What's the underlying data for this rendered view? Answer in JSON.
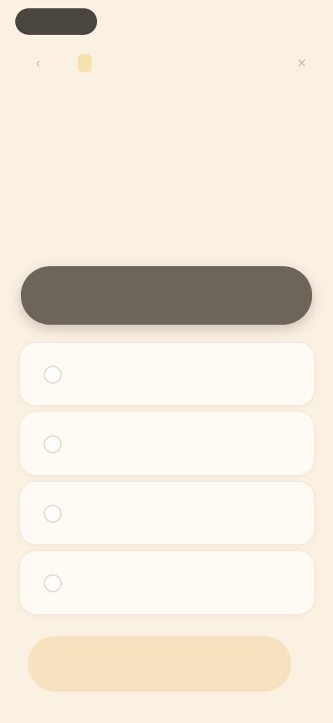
{
  "status_pill": "",
  "header": {
    "brand": "",
    "brand_sub": "",
    "back_icon": "back-icon",
    "close_icon": "close-icon"
  },
  "title": "",
  "subtitle": "",
  "primary_button": {
    "label": ""
  },
  "options": [
    {
      "label": ""
    },
    {
      "label": ""
    },
    {
      "label": ""
    },
    {
      "label": ""
    }
  ],
  "cta": {
    "label": ""
  },
  "colors": {
    "background": "#fbf1e2",
    "primary": "#6e655a",
    "cta": "#f7e2bf",
    "text": "#5b524a"
  }
}
